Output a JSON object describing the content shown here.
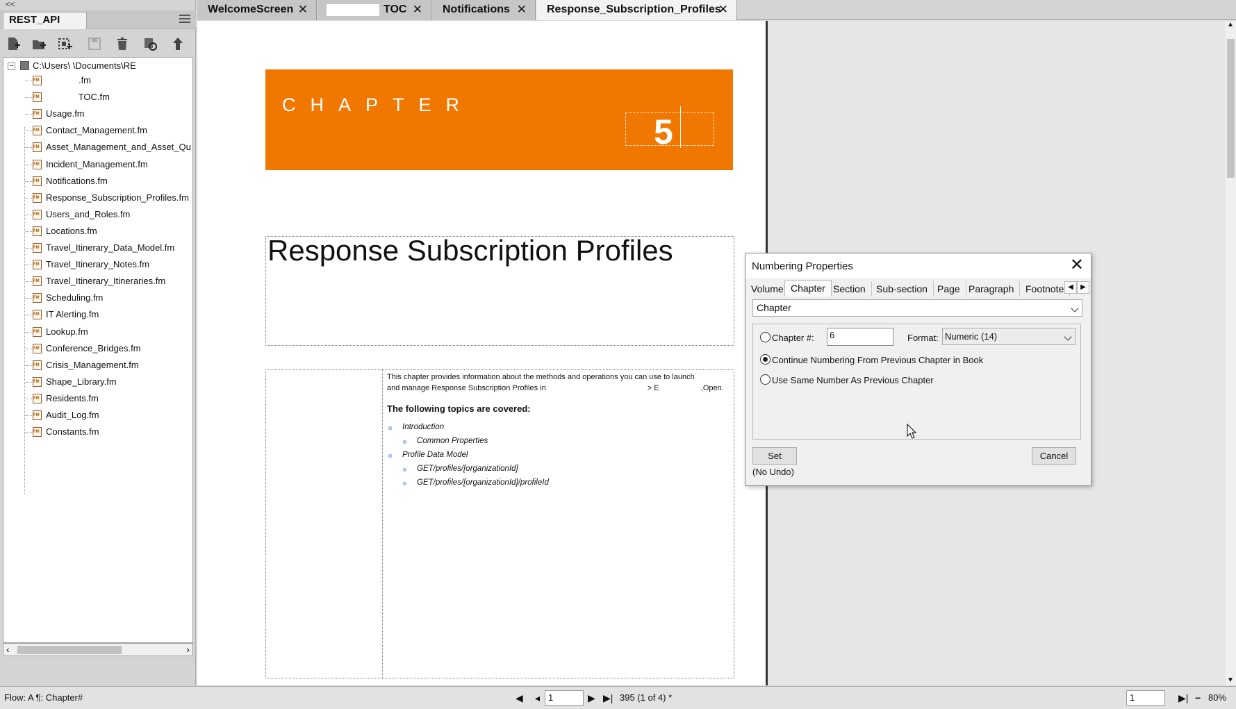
{
  "book_panel": {
    "collapse_glyph": "<<",
    "tab_label": "REST_API",
    "tree": {
      "root_label": "C:\\Users\\              \\Documents\\RE",
      "items": [
        {
          "label": "             .fm"
        },
        {
          "label": "             TOC.fm"
        },
        {
          "label": "Usage.fm"
        },
        {
          "label": "Contact_Management.fm"
        },
        {
          "label": "Asset_Management_and_Asset_Qu"
        },
        {
          "label": "Incident_Management.fm"
        },
        {
          "label": "Notifications.fm"
        },
        {
          "label": "Response_Subscription_Profiles.fm"
        },
        {
          "label": "Users_and_Roles.fm"
        },
        {
          "label": "Locations.fm"
        },
        {
          "label": "Travel_Itinerary_Data_Model.fm"
        },
        {
          "label": "Travel_Itinerary_Notes.fm"
        },
        {
          "label": "Travel_Itinerary_Itineraries.fm"
        },
        {
          "label": "Scheduling.fm"
        },
        {
          "label": "IT Alerting.fm"
        },
        {
          "label": "Lookup.fm"
        },
        {
          "label": "Conference_Bridges.fm"
        },
        {
          "label": "Crisis_Management.fm"
        },
        {
          "label": "Shape_Library.fm"
        },
        {
          "label": "Residents.fm"
        },
        {
          "label": "Audit_Log.fm"
        },
        {
          "label": "Constants.fm"
        }
      ]
    }
  },
  "doc_tabs": [
    {
      "label": "WelcomeScreen",
      "active": false
    },
    {
      "label": "TOC",
      "active": false
    },
    {
      "label": "Notifications",
      "active": false
    },
    {
      "label": "Response_Subscription_Profiles",
      "active": true
    }
  ],
  "tab_close_glyph": "✕",
  "document": {
    "chapter_word": "CHAPTER",
    "chapter_number": "5",
    "title": "Response Subscription Profiles",
    "intro_line1": "This chapter provides information about the methods and operations you can use to launch",
    "intro_line2a": "and manage Response Subscription Profiles in",
    "intro_line2b": "> E",
    "intro_line2c": ",Open.",
    "topics_heading": "The following topics are covered:",
    "topics": [
      {
        "text": "Introduction",
        "level": 1
      },
      {
        "text": "Common Properties",
        "level": 2
      },
      {
        "text": "Profile Data Model",
        "level": 1
      },
      {
        "text": "GET/profiles/[organizationId]",
        "level": 2
      },
      {
        "text": "GET/profiles/[organizationId]/profileId",
        "level": 2
      }
    ]
  },
  "status_bar": {
    "flow_text": "Flow: A  ¶: Chapter#",
    "page_value": "1",
    "page_count": "395 (1 of 4) *",
    "zoom_page_value": "1",
    "zoom": "80%"
  },
  "dialog": {
    "title": "Numbering Properties",
    "tabs": [
      "Volume",
      "Chapter",
      "Section",
      "Sub-section",
      "Page",
      "Paragraph",
      "Footnote"
    ],
    "active_tab": "Chapter",
    "selector": "Chapter",
    "chapter_label": "Chapter #:",
    "chapter_value": "6",
    "format_label": "Format:",
    "format_value": "Numeric  (14)",
    "option_continue": "Continue Numbering From Previous Chapter in Book",
    "option_same": "Use Same Number As Previous Chapter",
    "selected_option": "continue",
    "set_label": "Set",
    "cancel_label": "Cancel",
    "no_undo": "(No Undo)"
  },
  "colors": {
    "chapter_banner": "#f07800",
    "bullet": "#b4c5e8"
  }
}
